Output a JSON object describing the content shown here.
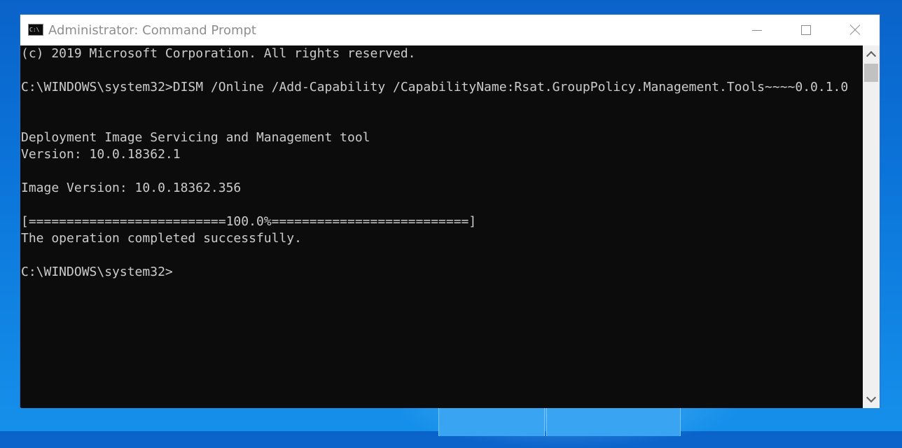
{
  "window": {
    "title": "Administrator: Command Prompt",
    "app_icon_text": "C:\\",
    "icon": "console-icon"
  },
  "caption_buttons": {
    "minimize_icon": "minimize-icon",
    "maximize_icon": "maximize-icon",
    "close_icon": "close-icon"
  },
  "console": {
    "lines": [
      "(c) 2019 Microsoft Corporation. All rights reserved.",
      "",
      "C:\\WINDOWS\\system32>DISM /Online /Add-Capability /CapabilityName:Rsat.GroupPolicy.Management.Tools~~~~0.0.1.0",
      "",
      "",
      "Deployment Image Servicing and Management tool",
      "Version: 10.0.18362.1",
      "",
      "Image Version: 10.0.18362.356",
      "",
      "[==========================100.0%==========================]",
      "The operation completed successfully.",
      "",
      "C:\\WINDOWS\\system32>"
    ],
    "text_color": "#cccccc",
    "background": "#0c0c0c"
  },
  "scrollbar": {
    "up_icon": "scroll-up-icon",
    "down_icon": "scroll-down-icon"
  }
}
